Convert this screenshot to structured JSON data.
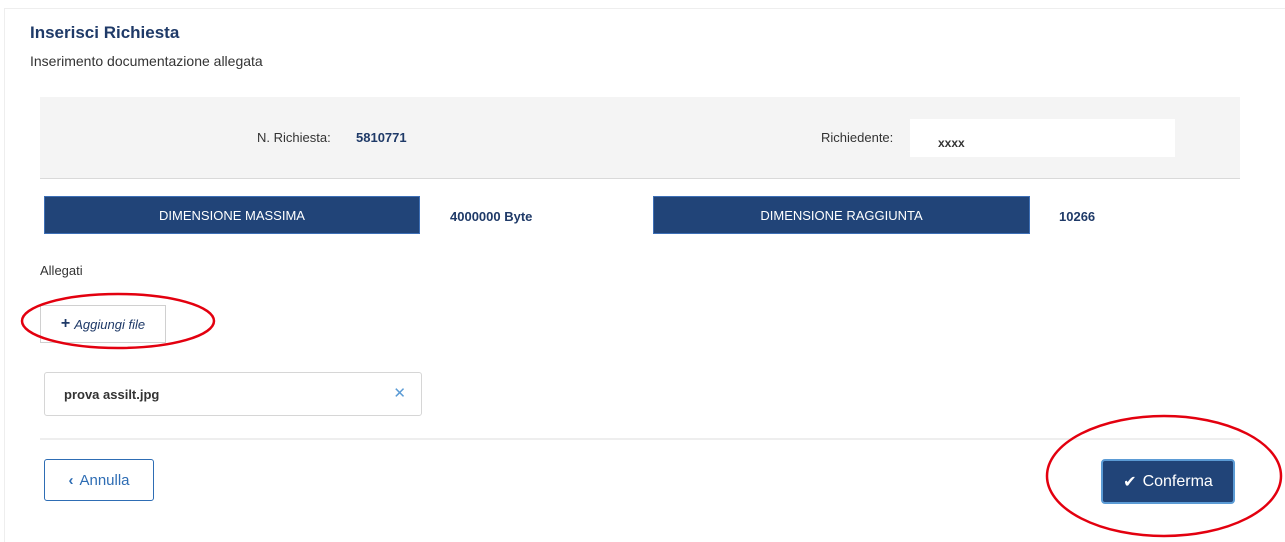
{
  "header": {
    "title": "Inserisci Richiesta",
    "subtitle": "Inserimento documentazione allegata"
  },
  "info": {
    "request_number_label": "N. Richiesta:",
    "request_number_value": "5810771",
    "requester_label": "Richiedente:",
    "requester_value": "xxxx"
  },
  "dimensions": {
    "max_label": "DIMENSIONE MASSIMA",
    "max_value": "4000000 Byte",
    "reached_label": "DIMENSIONE RAGGIUNTA",
    "reached_value": "10266"
  },
  "attachments": {
    "section_label": "Allegati",
    "add_button_label": "Aggiungi file",
    "files": [
      {
        "name": "prova assilt.jpg"
      }
    ]
  },
  "footer": {
    "cancel_label": "Annulla",
    "confirm_label": "Conferma"
  },
  "colors": {
    "primary": "#214478",
    "link": "#2e6db4",
    "annotation": "#e3000f"
  },
  "icons": {
    "add": "plus-icon",
    "remove": "close-icon",
    "cancel": "chevron-left-icon",
    "confirm": "check-icon"
  }
}
